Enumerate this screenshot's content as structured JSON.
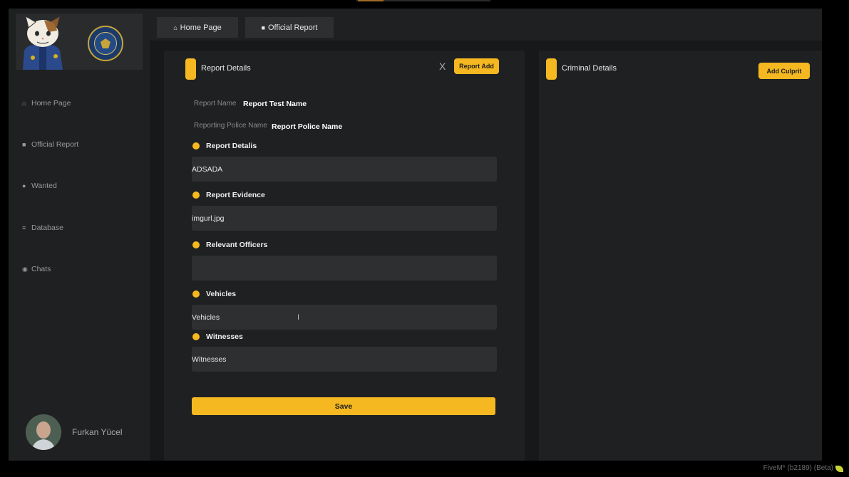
{
  "sidebar": {
    "items": [
      {
        "label": "Home Page",
        "icon": "home-icon"
      },
      {
        "label": "Official Report",
        "icon": "folder-icon"
      },
      {
        "label": "Wanted",
        "icon": "user-icon"
      },
      {
        "label": "Database",
        "icon": "database-icon"
      },
      {
        "label": "Chats",
        "icon": "chat-icon"
      }
    ],
    "user": {
      "name": "Furkan Yücel"
    }
  },
  "topbar": {
    "tabs": [
      {
        "label": "Home Page",
        "icon": "home-icon"
      },
      {
        "label": "Official Report",
        "icon": "folder-icon"
      }
    ]
  },
  "report": {
    "title": "Report Details",
    "close_label": "X",
    "add_label": "Report Add",
    "name_label": "Report Name",
    "name_value": "Report Test Name",
    "police_label": "Reporting Police Name",
    "police_value": "Report Police Name",
    "sections": [
      {
        "label": "Report Detalis",
        "value": "ADSADA"
      },
      {
        "label": "Report Evidence",
        "value": "imgurl.jpg"
      },
      {
        "label": "Relevant Officers",
        "value": ""
      },
      {
        "label": "Vehicles",
        "value": "Vehicles"
      },
      {
        "label": "Witnesses",
        "value": "Witnesses"
      }
    ],
    "save_label": "Save"
  },
  "criminal": {
    "title": "Criminal Details",
    "add_label": "Add Culprit"
  },
  "status_text": "FiveM* (b2189) (Beta)",
  "colors": {
    "accent": "#f5b820",
    "panel": "#1f2022",
    "field": "#2e2f31"
  }
}
